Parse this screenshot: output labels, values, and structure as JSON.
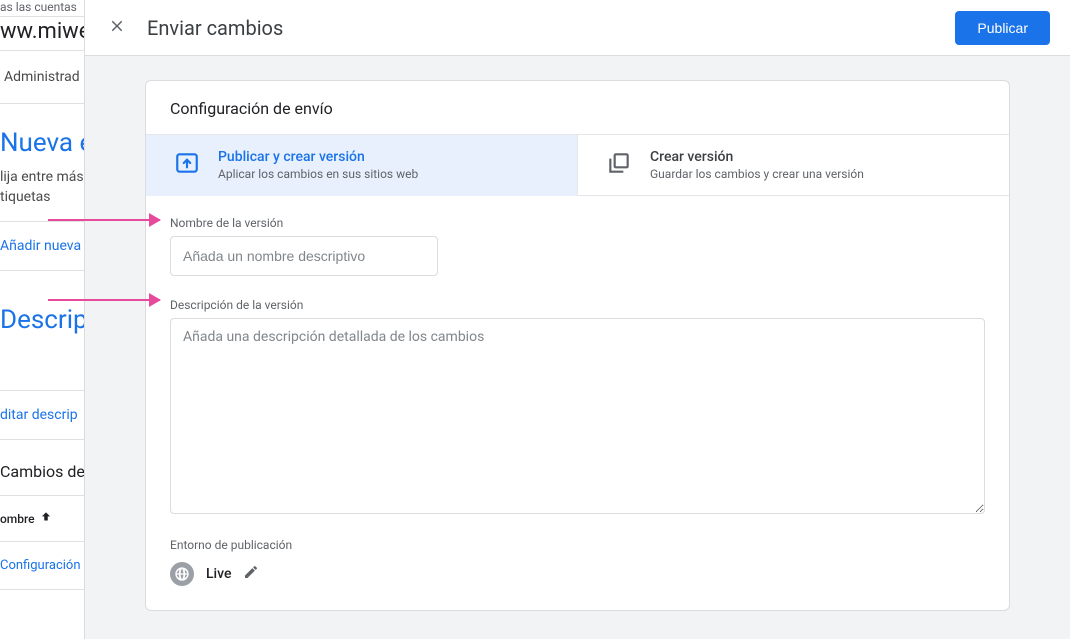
{
  "bg": {
    "accounts": "as las cuentas",
    "url": "ww.miwe",
    "admin": "Administrad",
    "new_tag_heading": "Nueva et",
    "new_tag_desc_l1": "lija entre más",
    "new_tag_desc_l2": "tiquetas",
    "add_new": "Añadir nueva",
    "descrip_heading": "Descripc",
    "edit_descrip": "ditar descrip",
    "changes_heading": "Cambios del",
    "col_name": "ombre",
    "config_row": "Configuración"
  },
  "modal": {
    "title": "Enviar cambios",
    "publish_button": "Publicar",
    "card_title": "Configuración de envío",
    "tabs": {
      "publish": {
        "label": "Publicar y crear versión",
        "sub": "Aplicar los cambios en sus sitios web"
      },
      "create": {
        "label": "Crear versión",
        "sub": "Guardar los cambios y crear una versión"
      }
    },
    "version_name_label": "Nombre de la versión",
    "version_name_placeholder": "Añada un nombre descriptivo",
    "version_desc_label": "Descripción de la versión",
    "version_desc_placeholder": "Añada una descripción detallada de los cambios",
    "env_label": "Entorno de publicación",
    "env_value": "Live"
  }
}
